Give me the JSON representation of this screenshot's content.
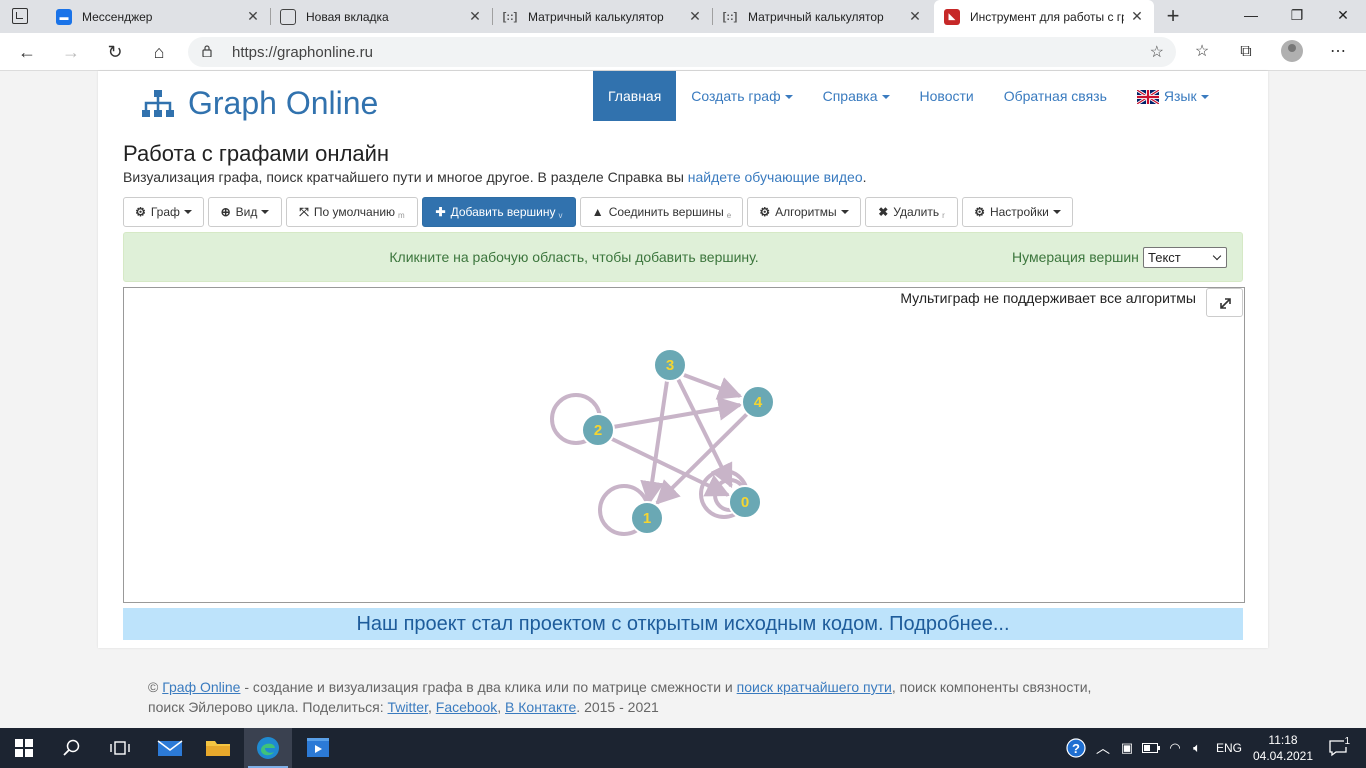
{
  "browser": {
    "tabs": [
      {
        "title": "Мессенджер",
        "icon": "messenger-icon",
        "color": "#1a73e8"
      },
      {
        "title": "Новая вкладка",
        "icon": "newtab-icon",
        "color": "#444444"
      },
      {
        "title": "Матричный калькулятор",
        "icon": "matrix-icon",
        "color": "#666666"
      },
      {
        "title": "Матричный калькулятор",
        "icon": "matrix-icon",
        "color": "#666666"
      },
      {
        "title": "Инструмент для работы с гр",
        "icon": "graphonline-icon",
        "color": "#c62828"
      }
    ],
    "url": "https://graphonline.ru"
  },
  "site": {
    "brand": "Graph Online",
    "nav": {
      "home": "Главная",
      "create": "Создать граф",
      "help": "Справка",
      "news": "Новости",
      "feedback": "Обратная связь",
      "language": "Язык"
    },
    "page_title": "Работа с графами онлайн",
    "subtitle": "Визуализация графа, поиск кратчайшего пути и многое другое. В разделе Справка вы",
    "subtitle_link": "найдете обучающие видео",
    "subtitle_end": ".",
    "toolbar": {
      "graph": "Граф",
      "view": "Вид",
      "default": "По умолчанию",
      "default_key": "m",
      "add_vertex": "Добавить вершину",
      "add_vertex_key": "v",
      "connect": "Соединить вершины",
      "connect_key": "e",
      "algorithms": "Алгоритмы",
      "delete": "Удалить",
      "delete_key": "r",
      "settings": "Настройки"
    },
    "alert": {
      "message": "Кликните на рабочую область, чтобы добавить вершину.",
      "numbering_label": "Нумерация вершин",
      "numbering_value": "Текст"
    },
    "canvas": {
      "notice": "Мультиграф не поддерживает все алгоритмы"
    },
    "graph": {
      "vertices": [
        "0",
        "1",
        "2",
        "3",
        "4"
      ],
      "edges": [
        {
          "from": "3",
          "to": "4"
        },
        {
          "from": "3",
          "to": "0"
        },
        {
          "from": "3",
          "to": "1"
        },
        {
          "from": "2",
          "to": "4"
        },
        {
          "from": "2",
          "to": "0"
        },
        {
          "from": "4",
          "to": "1"
        },
        {
          "from": "2",
          "to": "2"
        },
        {
          "from": "1",
          "to": "1"
        },
        {
          "from": "0",
          "to": "0"
        }
      ],
      "vertex_color": "#6aa8b4",
      "label_color": "#f5d531",
      "edge_color": "#c8b4c8"
    },
    "banner": "Наш проект стал проектом с открытым исходным кодом. Подробнее...",
    "footer": {
      "copyright": "©",
      "site_link": "Граф Online",
      "text1": "- создание и визуализация графа в два клика или по матрице смежности и",
      "shortest_link": "поиск кратчайшего пути",
      "text2": ", поиск компоненты связности,",
      "text3": "поиск Эйлерово цикла. Поделиться:",
      "twitter": "Twitter",
      "facebook": "Facebook",
      "vk": "В Контакте",
      "years": ". 2015 - 2021"
    }
  },
  "taskbar": {
    "lang": "ENG",
    "time": "11:18",
    "date": "04.04.2021",
    "notifications": "1"
  }
}
